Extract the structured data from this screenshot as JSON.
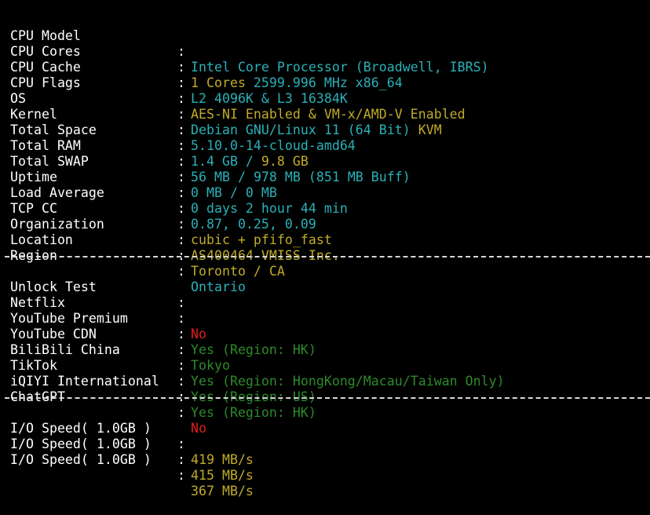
{
  "window": {
    "background": "#000000"
  },
  "colors": {
    "cyan": "#2ab0b7",
    "yellow": "#c0ab29",
    "red": "#e21d1d",
    "green": "#2d8a2a",
    "white": "#ffffff"
  },
  "system_info": [
    {
      "label": "CPU Model",
      "sep": ":",
      "value_a": "Intel Core Processor (Broadwell, IBRS)",
      "value_b": ""
    },
    {
      "label": "CPU Cores",
      "sep": ":",
      "value_a": "1 Cores",
      "value_b": " 2599.996 MHz x86_64"
    },
    {
      "label": "CPU Cache",
      "sep": ":",
      "value_a": "L2 4096K & L3 16384K",
      "value_b": ""
    },
    {
      "label": "CPU Flags",
      "sep": ":",
      "value_a": "AES-NI Enabled & VM-x/AMD-V Enabled",
      "value_b": ""
    },
    {
      "label": "OS",
      "sep": ":",
      "value_a": "Debian GNU/Linux 11 (64 Bit)",
      "value_b": " KVM"
    },
    {
      "label": "Kernel",
      "sep": ":",
      "value_a": "5.10.0-14-cloud-amd64",
      "value_b": ""
    },
    {
      "label": "Total Space",
      "sep": ":",
      "value_a": "1.4 GB / ",
      "value_b": "9.8 GB"
    },
    {
      "label": "Total RAM",
      "sep": ":",
      "value_a": "56 MB / ",
      "value_b": "978 MB (851 MB Buff)"
    },
    {
      "label": "Total SWAP",
      "sep": ":",
      "value_a": "0 MB / 0 MB",
      "value_b": ""
    },
    {
      "label": "Uptime",
      "sep": ":",
      "value_a": "0 days 2 hour 44 min",
      "value_b": ""
    },
    {
      "label": "Load Average",
      "sep": ":",
      "value_a": "0.87, 0.25, 0.09",
      "value_b": ""
    },
    {
      "label": "TCP CC",
      "sep": ":",
      "value_a": "cubic + pfifo_fast",
      "value_b": ""
    },
    {
      "label": "Organization",
      "sep": ":",
      "value_a": "AS400464 VMISS Inc.",
      "value_b": ""
    },
    {
      "label": "Location",
      "sep": ":",
      "value_a": "Toronto / CA",
      "value_b": ""
    },
    {
      "label": "Region",
      "sep": ":",
      "value_a": "Ontario",
      "value_b": ""
    }
  ],
  "unlock_test": [
    {
      "label": "Unlock Test",
      "sep": ":",
      "value": ""
    },
    {
      "label": "Netflix",
      "sep": ":",
      "value": "No"
    },
    {
      "label": "YouTube Premium",
      "sep": ":",
      "value": "Yes (Region: HK)"
    },
    {
      "label": "YouTube CDN",
      "sep": ":",
      "value": "Tokyo"
    },
    {
      "label": "BiliBili China",
      "sep": ":",
      "value": "Yes (Region: HongKong/Macau/Taiwan Only)"
    },
    {
      "label": "TikTok",
      "sep": ":",
      "value": "Yes (Region: US)"
    },
    {
      "label": "iQIYI International",
      "sep": ":",
      "value": "Yes (Region: HK)"
    },
    {
      "label": "ChatGPT",
      "sep": ":",
      "value": "No"
    }
  ],
  "io_speed": [
    {
      "label": "I/O Speed( 1.0GB )",
      "sep": ":",
      "value": "419 MB/s"
    },
    {
      "label": "I/O Speed( 1.0GB )",
      "sep": ":",
      "value": "415 MB/s"
    },
    {
      "label": "I/O Speed( 1.0GB )",
      "sep": ":",
      "value": "367 MB/s"
    }
  ]
}
